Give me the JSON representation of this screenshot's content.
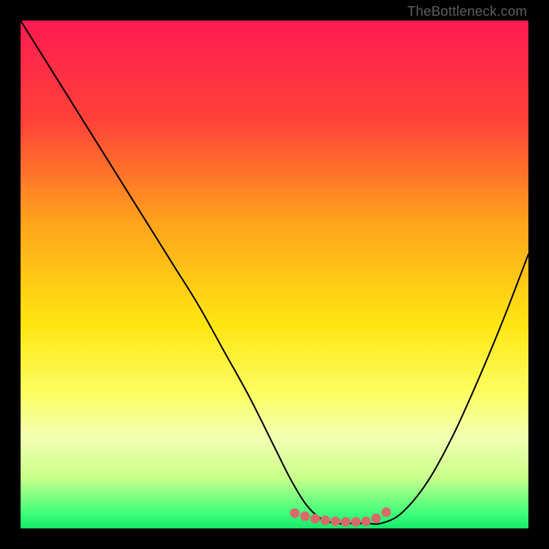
{
  "watermark": {
    "text": "TheBottleneck.com"
  },
  "chart_data": {
    "type": "line",
    "title": "",
    "xlabel": "",
    "ylabel": "",
    "xlim": [
      0,
      100
    ],
    "ylim": [
      0,
      100
    ],
    "gradient_stops": [
      {
        "pct": 0,
        "color": "#ff1a52"
      },
      {
        "pct": 20,
        "color": "#ff4338"
      },
      {
        "pct": 40,
        "color": "#ffa41b"
      },
      {
        "pct": 60,
        "color": "#ffe612"
      },
      {
        "pct": 74,
        "color": "#fbff66"
      },
      {
        "pct": 82,
        "color": "#f3ffb3"
      },
      {
        "pct": 90,
        "color": "#c9ff8a"
      },
      {
        "pct": 97,
        "color": "#3fff7a"
      },
      {
        "pct": 100,
        "color": "#17e86b"
      }
    ],
    "series": [
      {
        "name": "bottleneck-curve",
        "x": [
          0,
          5,
          10,
          15,
          20,
          25,
          30,
          35,
          40,
          45,
          50,
          53,
          56,
          59,
          62,
          65,
          68,
          71,
          75,
          80,
          85,
          90,
          95,
          100
        ],
        "y": [
          100,
          92,
          84,
          76,
          68,
          60,
          52,
          44,
          35,
          26,
          16,
          10,
          5,
          2,
          1,
          1,
          1,
          1,
          3,
          9,
          18,
          29,
          41,
          54
        ]
      }
    ],
    "notch_marks": {
      "name": "optimal-range-dots",
      "color": "#d86a6a",
      "radius": 7,
      "x": [
        54,
        56,
        58,
        60,
        62,
        64,
        66,
        68,
        70,
        72
      ],
      "y": [
        3,
        2.4,
        1.9,
        1.6,
        1.4,
        1.3,
        1.3,
        1.4,
        2.0,
        3.2
      ]
    }
  }
}
